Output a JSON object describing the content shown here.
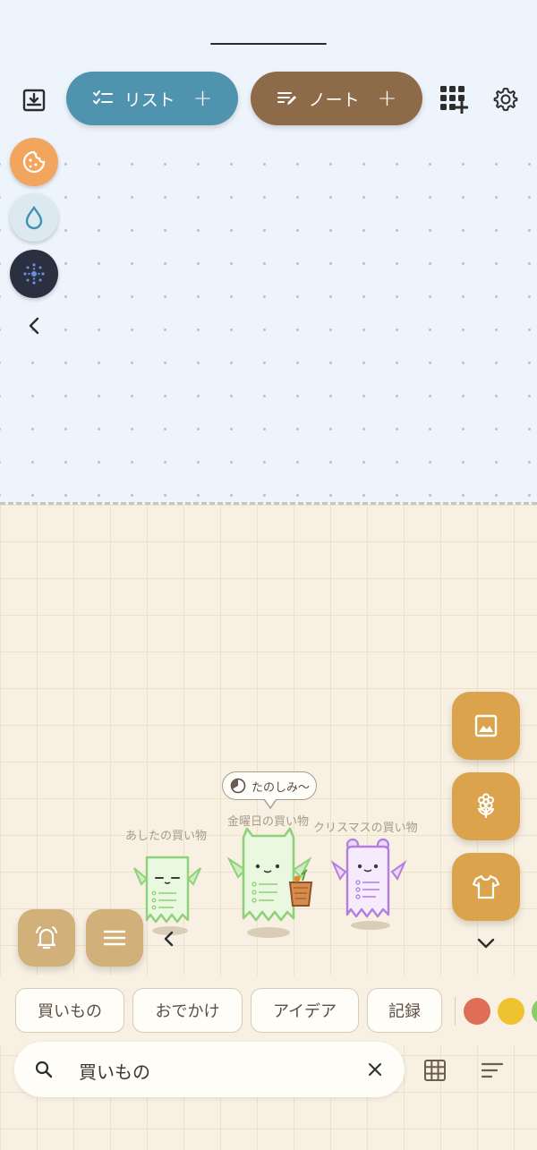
{
  "toolbar": {
    "list_label": "リスト",
    "note_label": "ノート",
    "list_color": "#4f93ae",
    "note_color": "#8d6a48"
  },
  "side_icons": [
    "cookie-icon",
    "drop-icon",
    "sparkle-icon",
    "chevron-left-icon"
  ],
  "characters": [
    {
      "label": "あしたの買い物",
      "color": "#8fd07a"
    },
    {
      "label": "金曜日の買い物",
      "color": "#8fd07a",
      "bubble": "たのしみ〜"
    },
    {
      "label": "クリスマスの買い物",
      "color": "#b27ee0"
    }
  ],
  "right_fabs": [
    "image-icon",
    "flower-icon",
    "shirt-icon"
  ],
  "tags": [
    "買いもの",
    "おでかけ",
    "アイデア",
    "記録"
  ],
  "tag_colors": [
    "#e06d55",
    "#efc230",
    "#8ccc6a"
  ],
  "search": {
    "value": "買いもの"
  }
}
